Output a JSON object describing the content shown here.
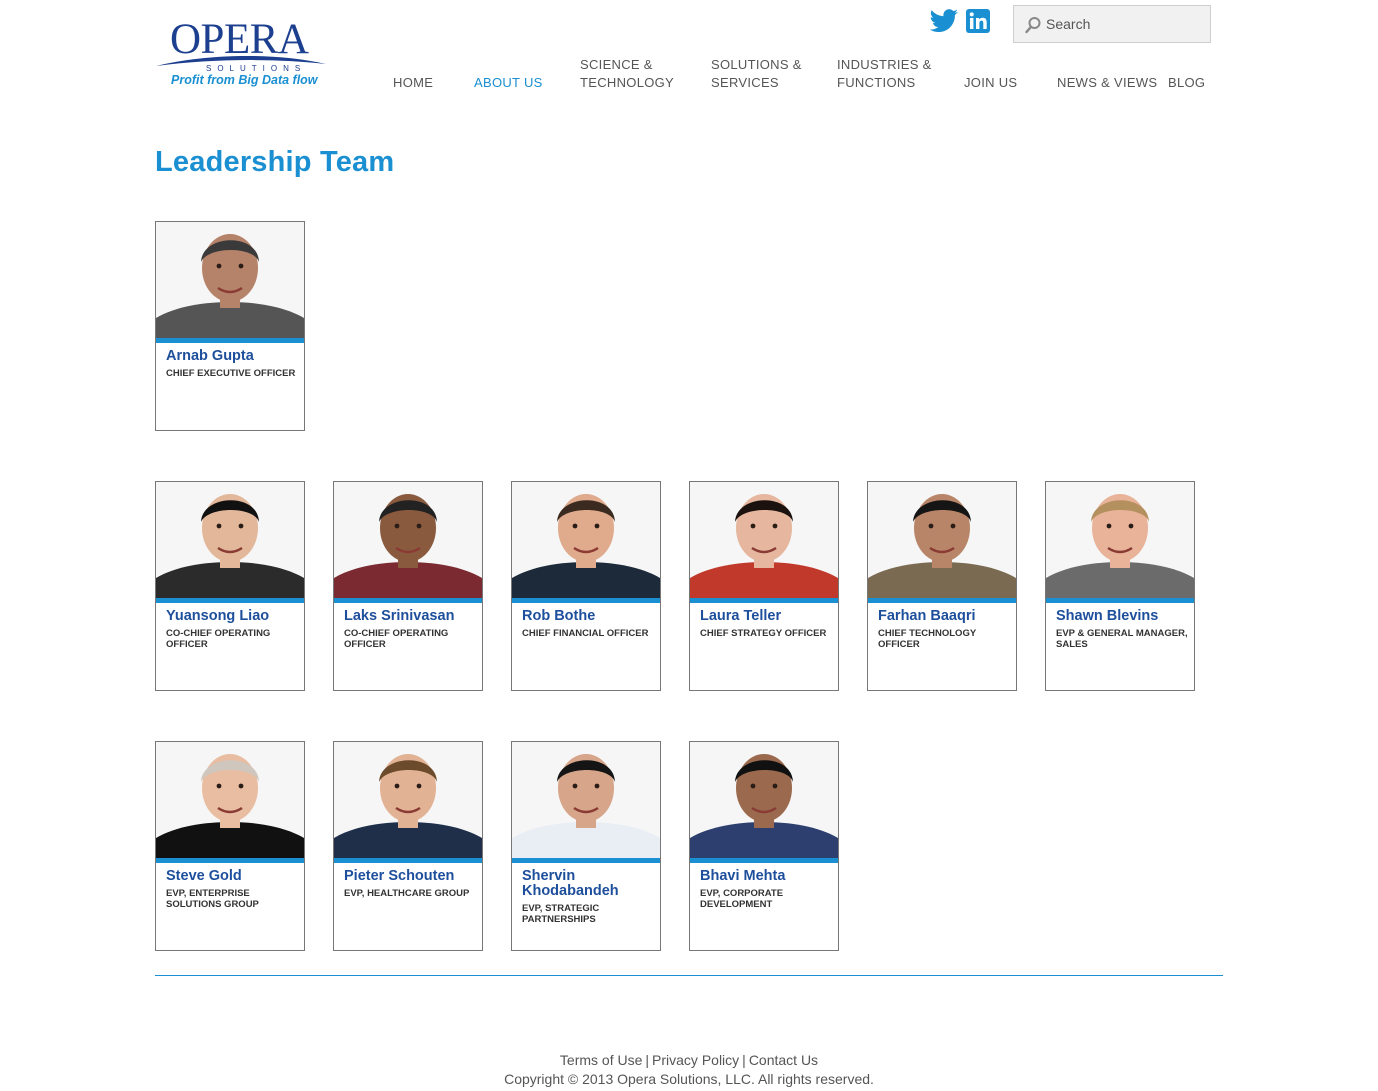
{
  "logo": {
    "word": "OPERA",
    "sub": "SOLUTIONS",
    "tagline": "Profit from Big Data flow"
  },
  "social": {
    "twitter": "twitter-icon",
    "linkedin": "linkedin-icon"
  },
  "search": {
    "placeholder": "Search"
  },
  "nav": [
    {
      "line1": "",
      "line2": "HOME"
    },
    {
      "line1": "",
      "line2": "ABOUT US",
      "active": true
    },
    {
      "line1": "SCIENCE &",
      "line2": "TECHNOLOGY"
    },
    {
      "line1": "SOLUTIONS &",
      "line2": "SERVICES"
    },
    {
      "line1": "INDUSTRIES &",
      "line2": "FUNCTIONS"
    },
    {
      "line1": "",
      "line2": "JOIN US"
    },
    {
      "line1": "",
      "line2": "NEWS & VIEWS"
    },
    {
      "line1": "",
      "line2": "BLOG"
    }
  ],
  "page_title": "Leadership Team",
  "colors": {
    "accent": "#1a8fd1",
    "brand": "#1d3f8f",
    "name": "#1e4f9c"
  },
  "leaders": [
    {
      "name": "Arnab Gupta",
      "role": "CHIEF EXECUTIVE OFFICER"
    },
    {
      "name": "Yuansong Liao",
      "role": "CO-CHIEF OPERATING OFFICER"
    },
    {
      "name": "Laks Srinivasan",
      "role": "CO-CHIEF OPERATING OFFICER"
    },
    {
      "name": "Rob Bothe",
      "role": "CHIEF FINANCIAL OFFICER"
    },
    {
      "name": "Laura Teller",
      "role": "CHIEF STRATEGY OFFICER"
    },
    {
      "name": "Farhan Baaqri",
      "role": "CHIEF TECHNOLOGY OFFICER"
    },
    {
      "name": "Shawn Blevins",
      "role": "EVP & GENERAL MANAGER, SALES"
    },
    {
      "name": "Steve Gold",
      "role": "EVP, ENTERPRISE SOLUTIONS GROUP"
    },
    {
      "name": "Pieter Schouten",
      "role": "EVP, HEALTHCARE GROUP"
    },
    {
      "name": "Shervin Khodabandeh",
      "role": "EVP, STRATEGIC PARTNERSHIPS"
    },
    {
      "name": "Bhavi Mehta",
      "role": "EVP, CORPORATE DEVELOPMENT"
    }
  ],
  "footer": {
    "links": [
      "Terms of Use",
      "Privacy Policy",
      "Contact Us"
    ],
    "separator": "|",
    "copyright": "Copyright © 2013 Opera Solutions, LLC. All rights reserved."
  }
}
